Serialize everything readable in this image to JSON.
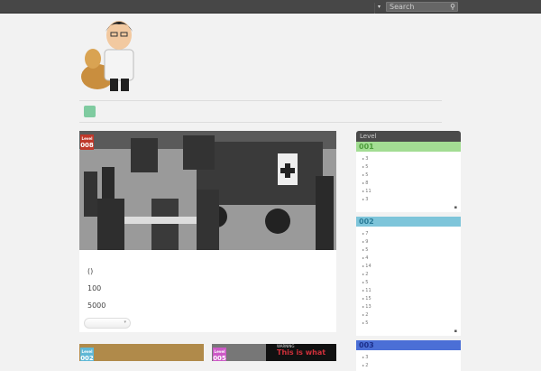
{
  "topbar": {
    "search_placeholder": "Search",
    "dropdown": "▾"
  },
  "main_post": {
    "level_label": "Level",
    "level": "008",
    "lines": [
      "()",
      "100",
      "5000"
    ]
  },
  "sidebar": {
    "title": "Level",
    "sections": [
      {
        "name": "001",
        "color": "#a3dd93",
        "text_color": "#4e9c3c",
        "items": [
          "3",
          "5",
          "5",
          "8",
          "11",
          "3"
        ]
      },
      {
        "name": "002",
        "color": "#7ec5da",
        "text_color": "#2a7c98",
        "items": [
          "7",
          "9",
          "5",
          "4",
          "14",
          "2",
          "5",
          "11",
          "15",
          "13",
          "2",
          "5"
        ]
      },
      {
        "name": "003",
        "color": "#4b6fd6",
        "text_color": "#1c2f8a",
        "items": [
          "3",
          "2"
        ]
      }
    ]
  },
  "tiles": [
    {
      "level_label": "Level",
      "level": "002",
      "color": "#5fb8d6"
    },
    {
      "level_label": "Level",
      "level": "005",
      "color": "#cc5ac6",
      "headline": "This is what",
      "warning": "WARNING"
    }
  ]
}
